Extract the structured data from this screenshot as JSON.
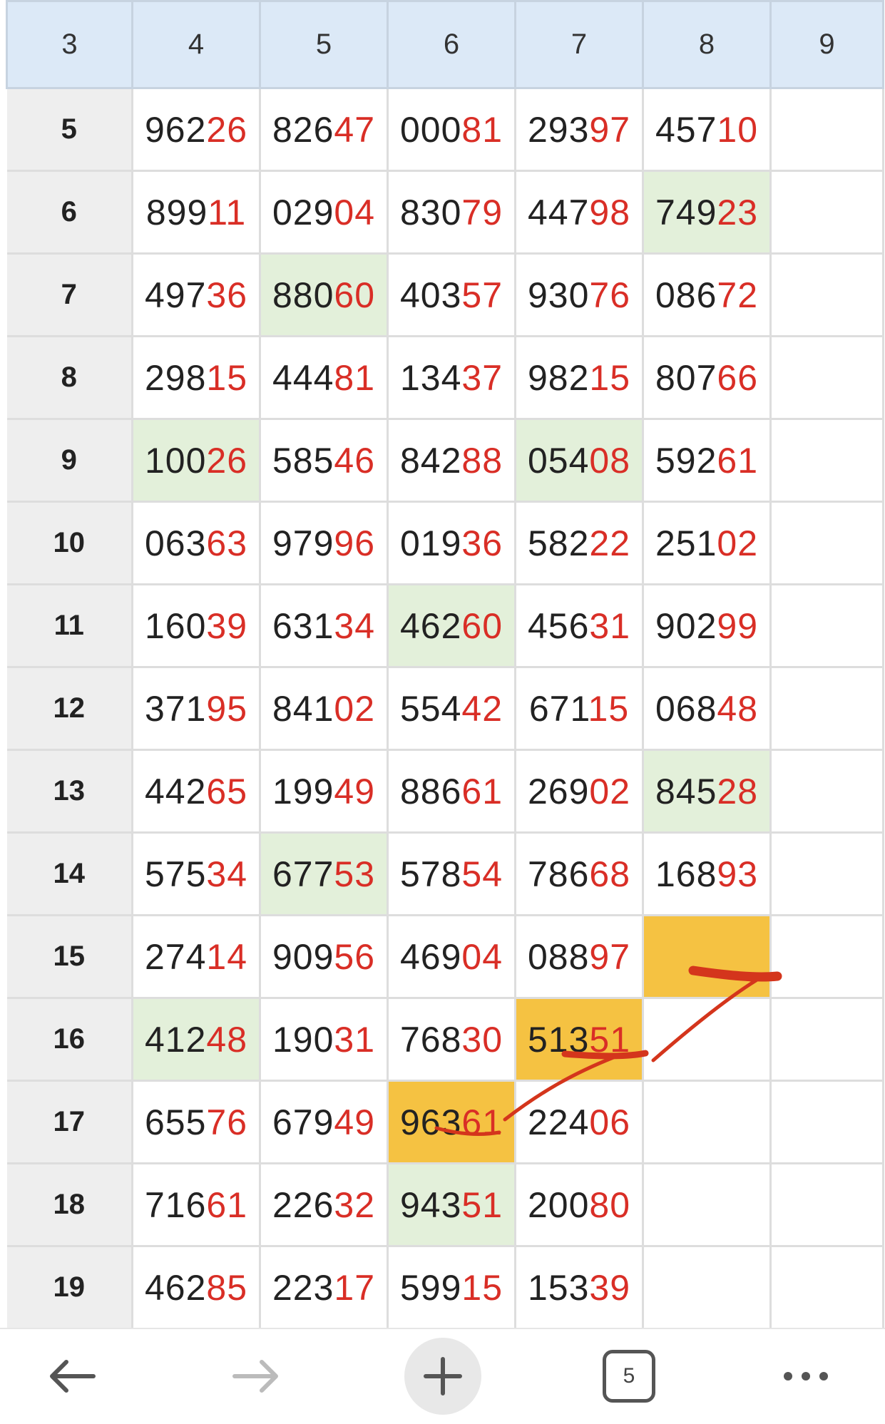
{
  "columns": [
    "3",
    "4",
    "5",
    "6",
    "7",
    "8",
    "9"
  ],
  "rows": [
    {
      "label": "5",
      "cells": [
        {
          "d": "96226"
        },
        {
          "d": "82647"
        },
        {
          "d": "00081"
        },
        {
          "d": "29397"
        },
        {
          "d": "45710"
        },
        {
          "d": ""
        }
      ]
    },
    {
      "label": "6",
      "cells": [
        {
          "d": "89911"
        },
        {
          "d": "02904"
        },
        {
          "d": "83079"
        },
        {
          "d": "44798"
        },
        {
          "d": "74923",
          "bg": "green"
        },
        {
          "d": ""
        }
      ]
    },
    {
      "label": "7",
      "cells": [
        {
          "d": "49736"
        },
        {
          "d": "88060",
          "bg": "green"
        },
        {
          "d": "40357"
        },
        {
          "d": "93076"
        },
        {
          "d": "08672"
        },
        {
          "d": ""
        }
      ]
    },
    {
      "label": "8",
      "cells": [
        {
          "d": "29815"
        },
        {
          "d": "44481"
        },
        {
          "d": "13437"
        },
        {
          "d": "98215"
        },
        {
          "d": "80766"
        },
        {
          "d": ""
        }
      ]
    },
    {
      "label": "9",
      "cells": [
        {
          "d": "10026",
          "bg": "green"
        },
        {
          "d": "58546"
        },
        {
          "d": "84288"
        },
        {
          "d": "05408",
          "bg": "green"
        },
        {
          "d": "59261"
        },
        {
          "d": ""
        }
      ]
    },
    {
      "label": "10",
      "cells": [
        {
          "d": "06363"
        },
        {
          "d": "97996"
        },
        {
          "d": "01936"
        },
        {
          "d": "58222"
        },
        {
          "d": "25102"
        },
        {
          "d": ""
        }
      ]
    },
    {
      "label": "11",
      "cells": [
        {
          "d": "16039"
        },
        {
          "d": "63134"
        },
        {
          "d": "46260",
          "bg": "green"
        },
        {
          "d": "45631"
        },
        {
          "d": "90299"
        },
        {
          "d": ""
        }
      ]
    },
    {
      "label": "12",
      "cells": [
        {
          "d": "37195"
        },
        {
          "d": "84102"
        },
        {
          "d": "55442"
        },
        {
          "d": "67115"
        },
        {
          "d": "06848"
        },
        {
          "d": ""
        }
      ]
    },
    {
      "label": "13",
      "cells": [
        {
          "d": "44265"
        },
        {
          "d": "19949"
        },
        {
          "d": "88661"
        },
        {
          "d": "26902"
        },
        {
          "d": "84528",
          "bg": "green"
        },
        {
          "d": ""
        }
      ]
    },
    {
      "label": "14",
      "cells": [
        {
          "d": "57534"
        },
        {
          "d": "67753",
          "bg": "green"
        },
        {
          "d": "57854"
        },
        {
          "d": "78668"
        },
        {
          "d": "16893"
        },
        {
          "d": ""
        }
      ]
    },
    {
      "label": "15",
      "cells": [
        {
          "d": "27414"
        },
        {
          "d": "90956"
        },
        {
          "d": "46904"
        },
        {
          "d": "08897"
        },
        {
          "d": "",
          "bg": "orange"
        },
        {
          "d": ""
        }
      ]
    },
    {
      "label": "16",
      "cells": [
        {
          "d": "41248",
          "bg": "green"
        },
        {
          "d": "19031"
        },
        {
          "d": "76830"
        },
        {
          "d": "51351",
          "bg": "orange"
        },
        {
          "d": ""
        },
        {
          "d": ""
        }
      ]
    },
    {
      "label": "17",
      "cells": [
        {
          "d": "65576"
        },
        {
          "d": "67949"
        },
        {
          "d": "96361",
          "bg": "orange"
        },
        {
          "d": "22406"
        },
        {
          "d": ""
        },
        {
          "d": ""
        }
      ]
    },
    {
      "label": "18",
      "cells": [
        {
          "d": "71661"
        },
        {
          "d": "22632"
        },
        {
          "d": "94351",
          "bg": "green"
        },
        {
          "d": "20080"
        },
        {
          "d": ""
        },
        {
          "d": ""
        }
      ]
    },
    {
      "label": "19",
      "cells": [
        {
          "d": "46285"
        },
        {
          "d": "22317"
        },
        {
          "d": "59915"
        },
        {
          "d": "15339"
        },
        {
          "d": ""
        },
        {
          "d": ""
        }
      ]
    }
  ],
  "toolbar": {
    "back_icon": "arrow-left-icon",
    "forward_icon": "arrow-right-icon",
    "new_tab_icon": "plus-icon",
    "tab_count": "5",
    "menu_icon": "more-dots-icon"
  },
  "colors": {
    "highlight_digits": "#d92e26",
    "green_cell": "#e3f0da",
    "orange_cell": "#f5c242",
    "annotation_ink": "#d4351c",
    "header_bg": "#dce9f7"
  }
}
